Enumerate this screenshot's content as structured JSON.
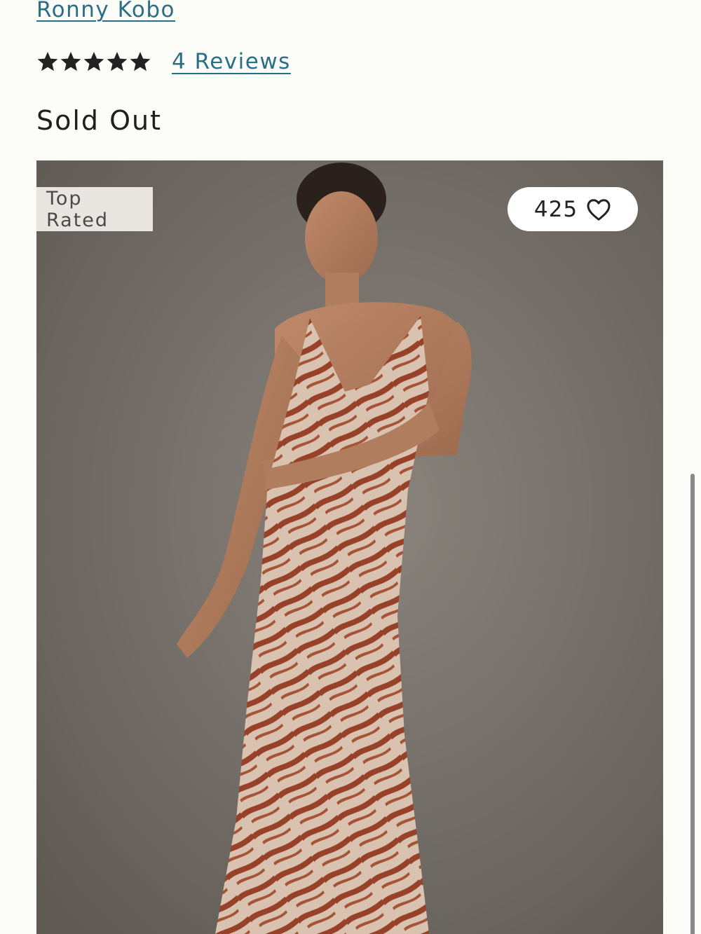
{
  "product": {
    "brand": "Ronny Kobo",
    "rating": 5,
    "rating_max": 5,
    "reviews_label": "4 Reviews",
    "availability": "Sold Out"
  },
  "image": {
    "badge_label": "Top Rated",
    "favorites_count": "425",
    "favorite_icon": "heart-outline-icon"
  },
  "colors": {
    "link": "#2b6f86",
    "star": "#222222",
    "image_background": "#767069",
    "badge_background": "#e9e5e0"
  }
}
